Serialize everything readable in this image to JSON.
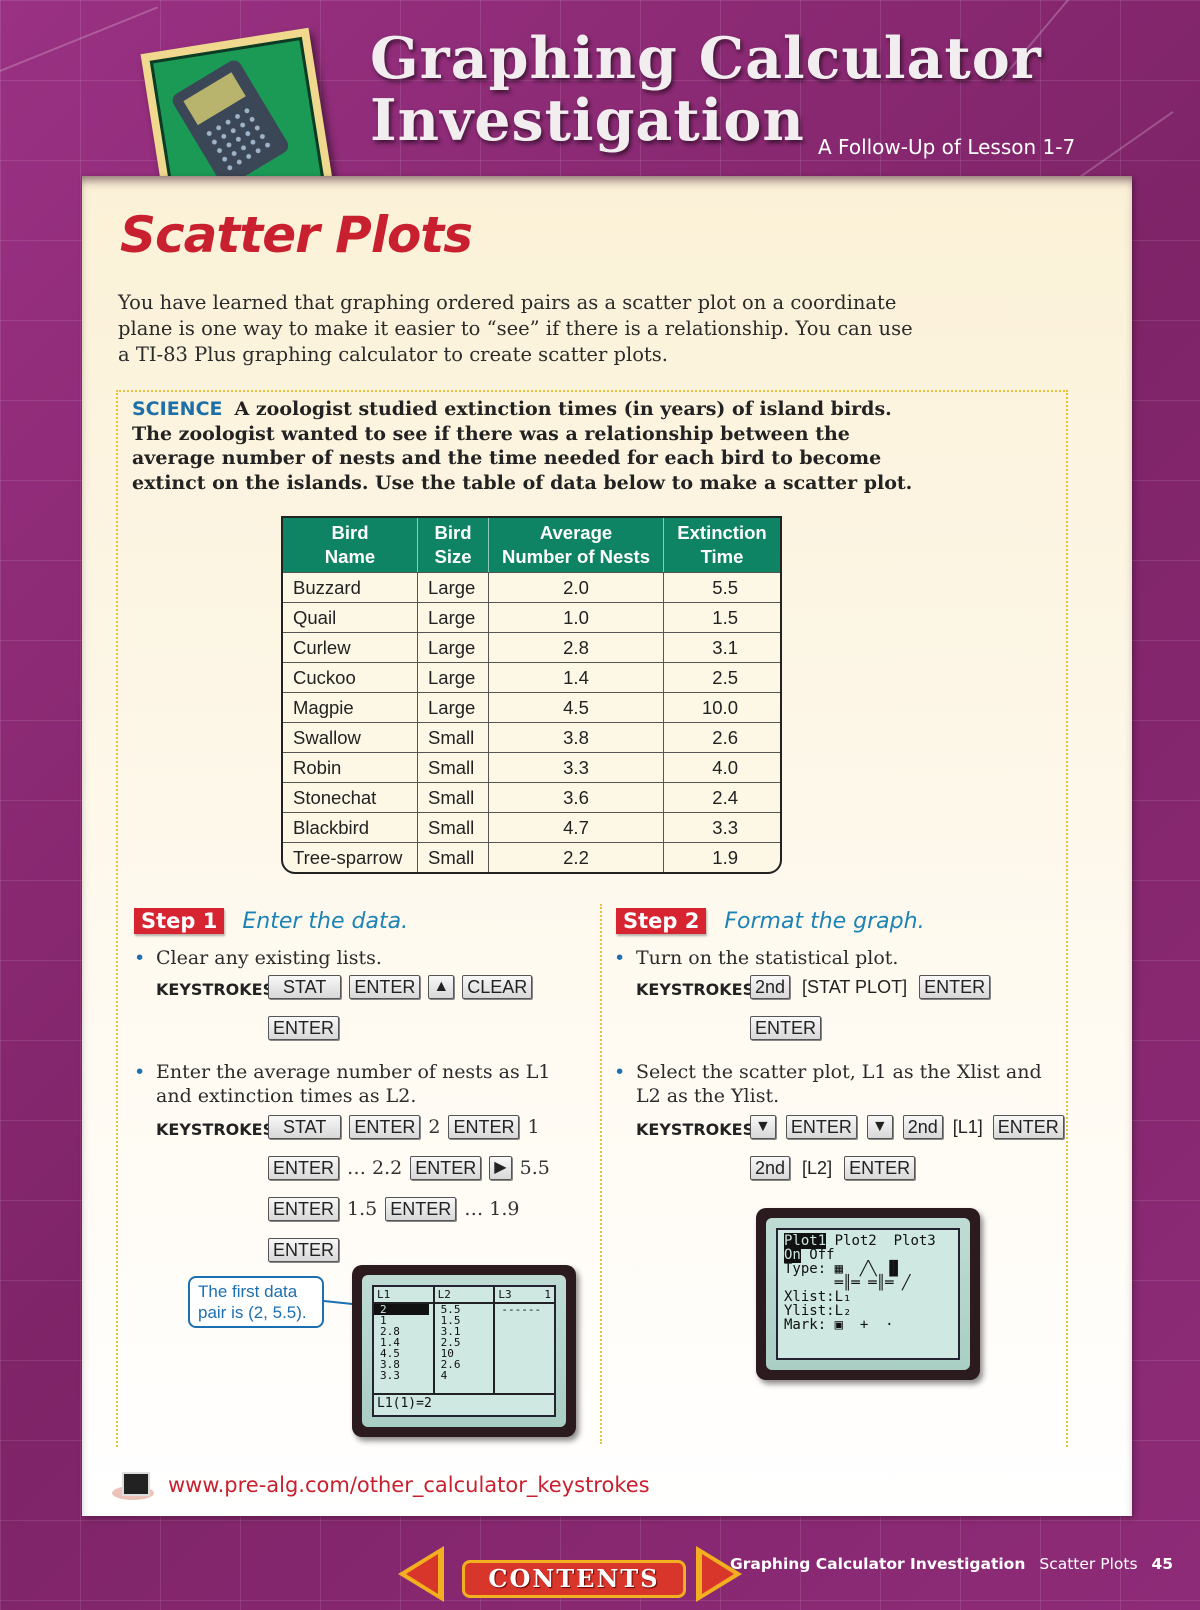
{
  "header": {
    "title_line1": "Graphing Calculator",
    "title_line2": "Investigation",
    "subtitle": "A Follow-Up of Lesson 1-7",
    "logo_icon": "calculator-icon"
  },
  "page_title": "Scatter Plots",
  "intro": "You have learned that graphing ordered pairs as a scatter plot on a coordinate plane is one way to make it easier to “see” if there is a relationship. You can use a TI-83 Plus graphing calculator to create scatter plots.",
  "science": {
    "tag": "SCIENCE",
    "text": "A zoologist studied extinction times (in years) of island birds. The zoologist wanted to see if there was a relationship between the average number of nests and the time needed for each bird to become extinct on the islands. Use the table of data below to make a scatter plot."
  },
  "table": {
    "headers": [
      [
        "Bird",
        "Name"
      ],
      [
        "Bird",
        "Size"
      ],
      [
        "Average",
        "Number of Nests"
      ],
      [
        "Extinction",
        "Time"
      ]
    ],
    "rows": [
      [
        "Buzzard",
        "Large",
        "2.0",
        "5.5"
      ],
      [
        "Quail",
        "Large",
        "1.0",
        "1.5"
      ],
      [
        "Curlew",
        "Large",
        "2.8",
        "3.1"
      ],
      [
        "Cuckoo",
        "Large",
        "1.4",
        "2.5"
      ],
      [
        "Magpie",
        "Large",
        "4.5",
        "10.0"
      ],
      [
        "Swallow",
        "Small",
        "3.8",
        "2.6"
      ],
      [
        "Robin",
        "Small",
        "3.3",
        "4.0"
      ],
      [
        "Stonechat",
        "Small",
        "3.6",
        "2.4"
      ],
      [
        "Blackbird",
        "Small",
        "4.7",
        "3.3"
      ],
      [
        "Tree-sparrow",
        "Small",
        "2.2",
        "1.9"
      ]
    ]
  },
  "keystrokes_label": "KEYSTROKES:",
  "step1": {
    "badge": "Step 1",
    "title": "Enter the data.",
    "bullet1": "Clear any existing lists.",
    "bullet2": "Enter the average number of nests as L1 and extinction times as L2.",
    "keys": {
      "stat": "STAT",
      "enter": "ENTER",
      "up": "▲",
      "right": "▶",
      "clear": "CLEAR",
      "v2": "2",
      "v1": "1",
      "v22": "… 2.2",
      "v55": "5.5",
      "v15": "1.5",
      "v19": "… 1.9"
    },
    "callout": "The first data pair is (2, 5.5).",
    "screen": {
      "headers": [
        "L1",
        "L2",
        "L3",
        "1"
      ],
      "l1": [
        "2",
        "1",
        "2.8",
        "1.4",
        "4.5",
        "3.8",
        "3.3"
      ],
      "l2": [
        "5.5",
        "1.5",
        "3.1",
        "2.5",
        "10",
        "2.6",
        "4"
      ],
      "l3": "------",
      "footer": "L1(1)=2"
    }
  },
  "step2": {
    "badge": "Step 2",
    "title": "Format the graph.",
    "bullet1": "Turn on the statistical plot.",
    "bullet2": "Select the scatter plot, L1 as the Xlist and L2 as the Ylist.",
    "keys": {
      "second": "2nd",
      "stat_plot": "[STAT PLOT]",
      "enter": "ENTER",
      "down": "▼",
      "l1": "[L1]",
      "l2": "[L2]"
    },
    "screen": {
      "line1_sel": "Plot1",
      "line1_rest": " Plot2  Plot3",
      "line2_sel": "On",
      "line2_rest": " Off",
      "line3": "Type: ▦  ╱╲ ▐▌",
      "line4": "      ═║═ ═║═ ╱",
      "line5": "Xlist:L₁",
      "line6": "Ylist:L₂",
      "line7": "Mark: ▣  +  ·"
    }
  },
  "web_link": "www.pre-alg.com/other_calculator_keystrokes",
  "footer": {
    "contents": "CONTENTS",
    "chapter": "Graphing Calculator Investigation",
    "section": "Scatter Plots",
    "page": "45"
  },
  "colors": {
    "background": "#8a2a72",
    "title_red": "#c8202e",
    "table_header": "#0f8465",
    "science_blue": "#1d6fa8",
    "step_badge": "#d62530",
    "step_title": "#1c83b6"
  }
}
